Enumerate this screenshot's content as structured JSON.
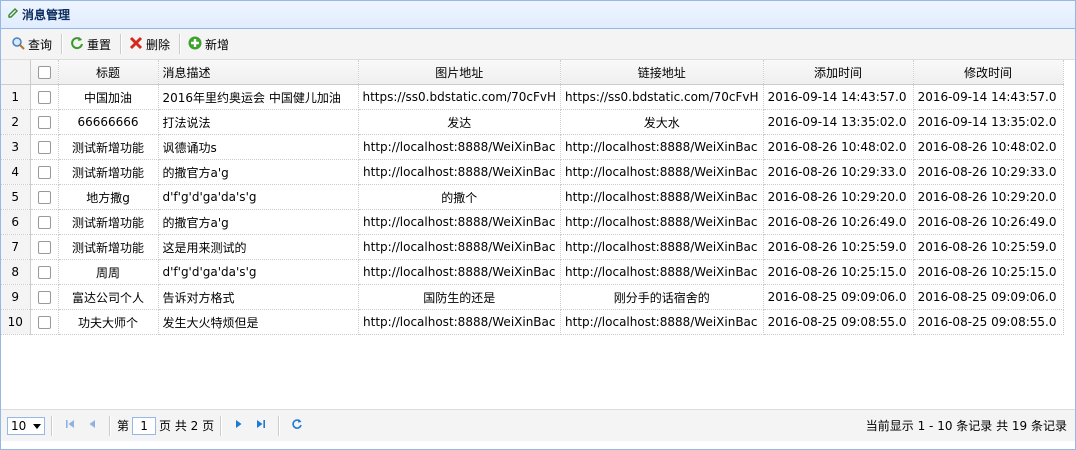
{
  "panel": {
    "title": "消息管理"
  },
  "toolbar": {
    "query_label": "查询",
    "reset_label": "重置",
    "delete_label": "删除",
    "add_label": "新增"
  },
  "columns": [
    "标题",
    "消息描述",
    "图片地址",
    "链接地址",
    "添加时间",
    "修改时间"
  ],
  "rows": [
    [
      "1",
      "中国加油",
      "2016年里约奥运会 中国健儿加油",
      "https://ss0.bdstatic.com/70cFvH",
      "https://ss0.bdstatic.com/70cFvH",
      "2016-09-14 14:43:57.0",
      "2016-09-14 14:43:57.0"
    ],
    [
      "2",
      "66666666",
      "打法说法",
      "发达",
      "发大水",
      "2016-09-14 13:35:02.0",
      "2016-09-14 13:35:02.0"
    ],
    [
      "3",
      "测试新增功能",
      "讽德诵功s",
      "http://localhost:8888/WeiXinBac",
      "http://localhost:8888/WeiXinBac",
      "2016-08-26 10:48:02.0",
      "2016-08-26 10:48:02.0"
    ],
    [
      "4",
      "测试新增功能",
      "的撒官方a'g",
      "http://localhost:8888/WeiXinBac",
      "http://localhost:8888/WeiXinBac",
      "2016-08-26 10:29:33.0",
      "2016-08-26 10:29:33.0"
    ],
    [
      "5",
      "地方撒g",
      "d'f'g'd'ga'da's'g",
      "的撒个",
      "http://localhost:8888/WeiXinBac",
      "2016-08-26 10:29:20.0",
      "2016-08-26 10:29:20.0"
    ],
    [
      "6",
      "测试新增功能",
      "的撒官方a'g",
      "http://localhost:8888/WeiXinBac",
      "http://localhost:8888/WeiXinBac",
      "2016-08-26 10:26:49.0",
      "2016-08-26 10:26:49.0"
    ],
    [
      "7",
      "测试新增功能",
      "这是用来测试的",
      "http://localhost:8888/WeiXinBac",
      "http://localhost:8888/WeiXinBac",
      "2016-08-26 10:25:59.0",
      "2016-08-26 10:25:59.0"
    ],
    [
      "8",
      "周周",
      "d'f'g'd'ga'da's'g",
      "http://localhost:8888/WeiXinBac",
      "http://localhost:8888/WeiXinBac",
      "2016-08-26 10:25:15.0",
      "2016-08-26 10:25:15.0"
    ],
    [
      "9",
      "富达公司个人",
      "告诉对方格式",
      "国防生的还是",
      "刚分手的话宿舍的",
      "2016-08-25 09:09:06.0",
      "2016-08-25 09:09:06.0"
    ],
    [
      "10",
      "功夫大师个",
      "发生大火特烦但是",
      "http://localhost:8888/WeiXinBac",
      "http://localhost:8888/WeiXinBac",
      "2016-08-25 09:08:55.0",
      "2016-08-25 09:08:55.0"
    ]
  ],
  "cell_align": [
    "c",
    "l",
    "c",
    "l",
    "l",
    "l"
  ],
  "cell_align_overrides": {
    "1": [
      "c",
      "l",
      "c",
      "c",
      "l",
      "l"
    ],
    "4": [
      "c",
      "l",
      "c",
      "l",
      "l",
      "l"
    ],
    "8": [
      "c",
      "l",
      "c",
      "c",
      "l",
      "l"
    ]
  },
  "pager": {
    "page_size": "10",
    "page_prefix": "第",
    "page_value": "1",
    "page_suffix": "页 共 2 页",
    "info": "当前显示 1 - 10 条记录 共 19 条记录"
  },
  "colors": {
    "accent": "#95b8e7",
    "header_text": "#0e2d5f"
  }
}
